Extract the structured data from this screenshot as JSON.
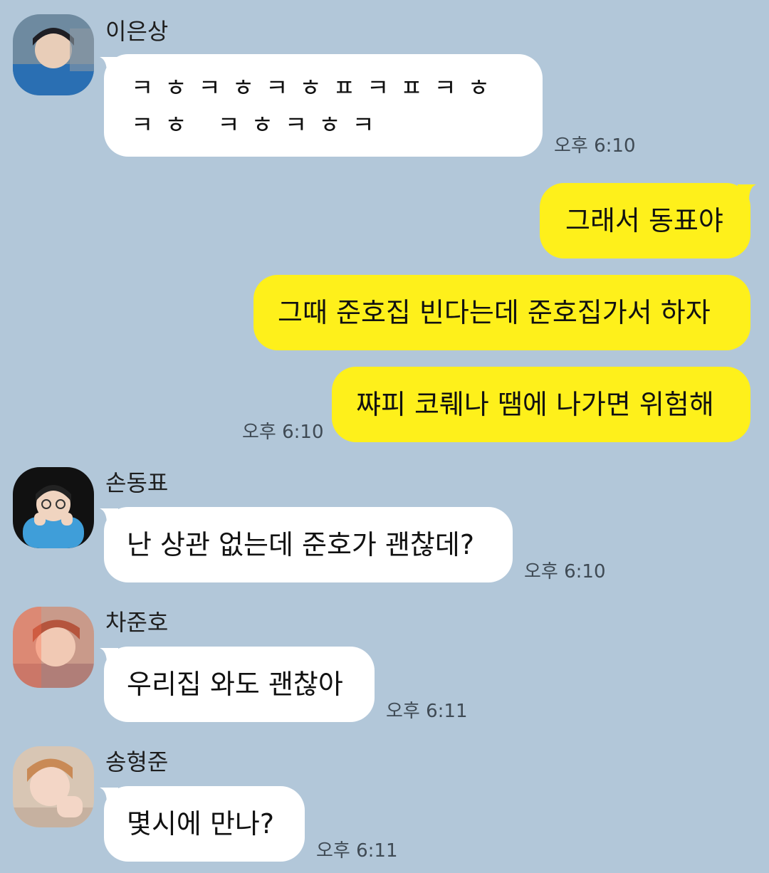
{
  "messages": [
    {
      "sender": "이은상",
      "text": "ㅋㅎㅋㅎㅋㅎㅍㅋㅍㅋㅎㅋㅎ ㅋㅎㅋㅎㅋ",
      "time": "오후 6:10",
      "direction": "incoming"
    },
    {
      "text": "그래서 동표야",
      "direction": "outgoing"
    },
    {
      "text": "그때 준호집 빈다는데 준호집가서 하자",
      "direction": "outgoing"
    },
    {
      "text": "쨔피 코뤠나 땜에 나가면 위험해",
      "time": "오후 6:10",
      "direction": "outgoing"
    },
    {
      "sender": "손동표",
      "text": "난 상관 없는데 준호가 괜찮데?",
      "time": "오후 6:10",
      "direction": "incoming"
    },
    {
      "sender": "차준호",
      "text": "우리집 와도 괜찮아",
      "time": "오후 6:11",
      "direction": "incoming"
    },
    {
      "sender": "송형준",
      "text": "몇시에 만나?",
      "time": "오후 6:11",
      "direction": "incoming"
    }
  ],
  "colors": {
    "background": "#b2c7d9",
    "incoming_bubble": "#ffffff",
    "outgoing_bubble": "#fef01b",
    "time_text": "#3f4a54"
  }
}
